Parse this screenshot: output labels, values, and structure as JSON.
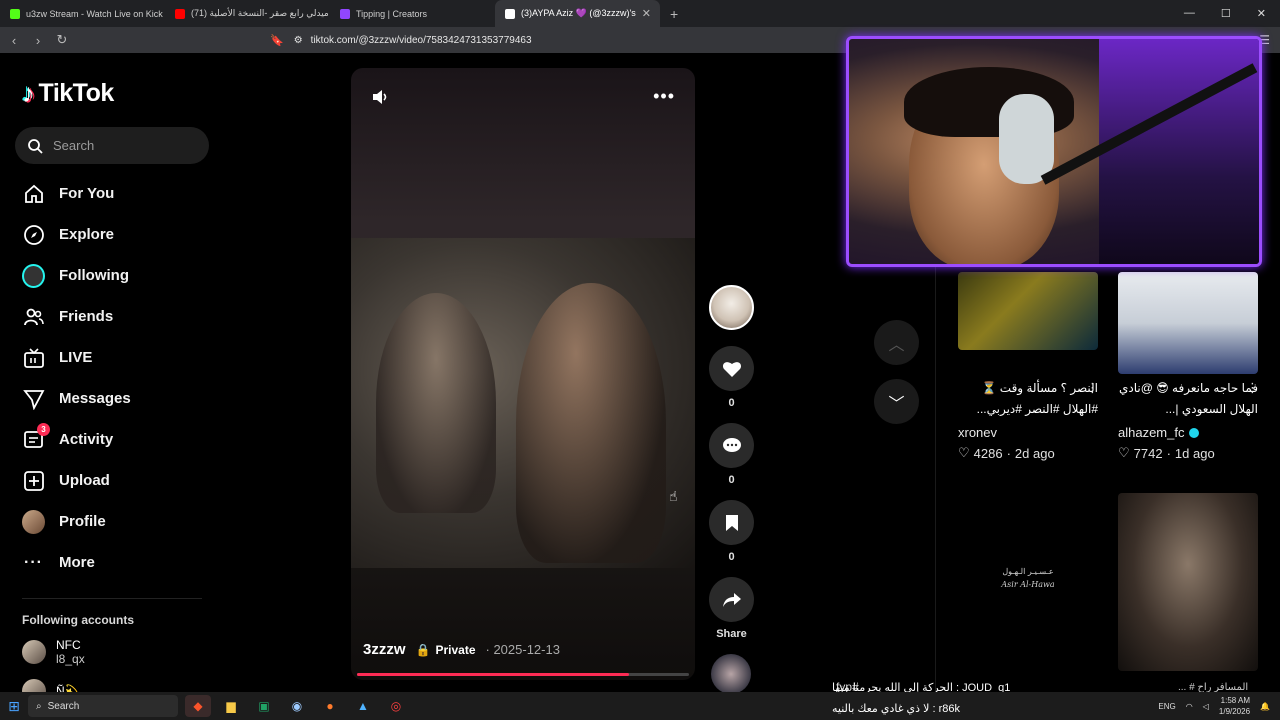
{
  "browser": {
    "tabs": [
      {
        "label": "u3zw Stream - Watch Live on Kick",
        "color": "#53fc18"
      },
      {
        "label": "(71) ميدلي رابع صقر -النسخة الأصلية",
        "color": "#ff0000"
      },
      {
        "label": "Tipping | Creators",
        "color": "#9146ff"
      },
      {
        "label": "(3)AYPA Aziz 💜 (@3zzzw)'s",
        "color": "#ffffff"
      }
    ],
    "url": "tiktok.com/@3zzzw/video/7583424731353779463"
  },
  "sidebar": {
    "logo": "TikTok",
    "search_placeholder": "Search",
    "nav": [
      {
        "label": "For You",
        "icon": "home-icon"
      },
      {
        "label": "Explore",
        "icon": "compass-icon"
      },
      {
        "label": "Following",
        "icon": "following-icon"
      },
      {
        "label": "Friends",
        "icon": "friends-icon"
      },
      {
        "label": "LIVE",
        "icon": "live-icon"
      },
      {
        "label": "Messages",
        "icon": "messages-icon"
      },
      {
        "label": "Activity",
        "icon": "activity-icon",
        "badge": "3"
      },
      {
        "label": "Upload",
        "icon": "upload-icon"
      },
      {
        "label": "Profile",
        "icon": "profile-icon"
      },
      {
        "label": "More",
        "icon": "more-icon"
      }
    ],
    "following_title": "Following accounts",
    "accounts": [
      {
        "name": "NFC",
        "handle": "l8_qx"
      },
      {
        "name": "Ñ💫",
        "handle": ""
      }
    ]
  },
  "video": {
    "username": "3zzzw",
    "privacy": "Private",
    "date": "· 2025-12-13",
    "progress": 0.82
  },
  "actions": {
    "likes": "0",
    "comments": "0",
    "saves": "0",
    "share": "Share"
  },
  "suggested": [
    {
      "title": "النصر ؟ مسألة وقت ⏳ #الهلال #النصر #ديربي...",
      "user": "xronev",
      "likes": "4286",
      "age": "2d ago",
      "verified": false
    },
    {
      "title": "فما حاجه مانعرفه 😎 @نادي الهلال السعودي |...",
      "user": "alhazem_fc",
      "likes": "7742",
      "age": "1d ago",
      "verified": true
    },
    {
      "thumb_text_ar": "عـسـيـر الـهـول",
      "thumb_text_en": "Asir Al-Hawa"
    }
  ],
  "chat_ticker": [
    "JOUD_q1 : الحركة إلي الله يحرمنا منها",
    "r86k : لا ذي غادي معك بالنيه"
  ],
  "ticker_tags": "#fyp",
  "ticker_tail": "المسافر راح # ...",
  "taskbar": {
    "search": "Search",
    "lang": "ENG",
    "time": "1:58 AM",
    "date": "1/9/2026"
  },
  "colors": {
    "accent": "#fe2c55",
    "webcam_border": "#9c4dff"
  }
}
